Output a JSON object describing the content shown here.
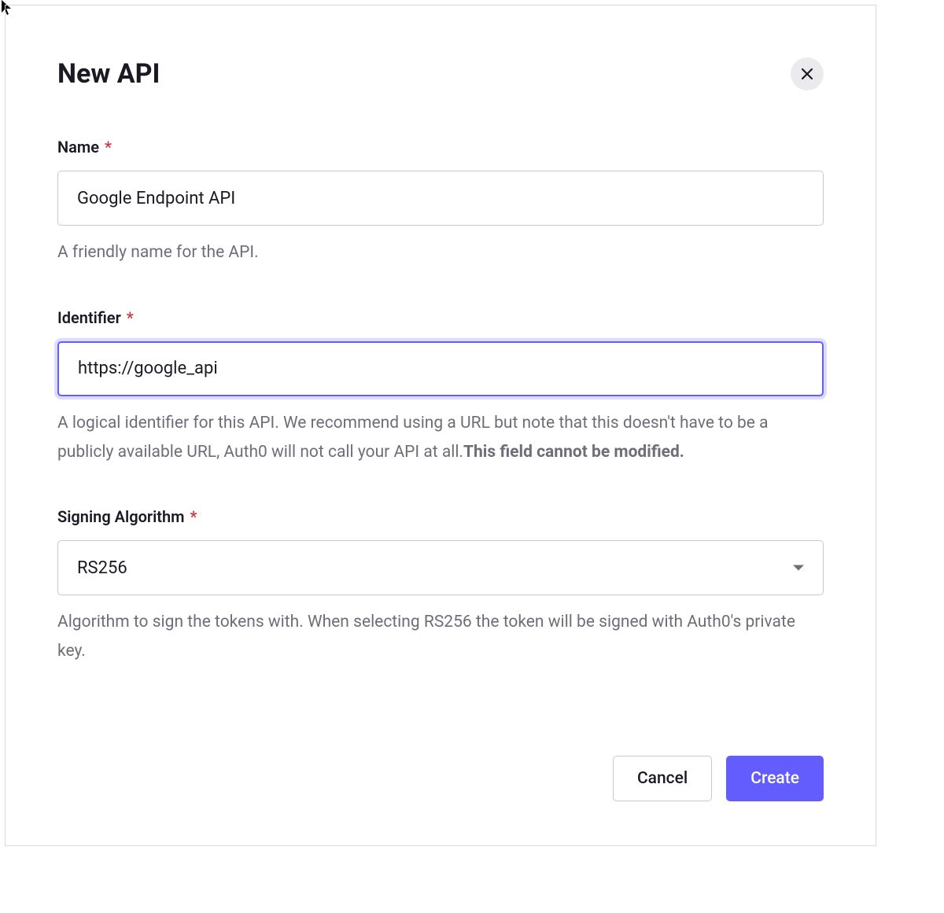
{
  "dialog": {
    "title": "New API",
    "fields": {
      "name": {
        "label": "Name",
        "value": "Google Endpoint API",
        "helper": "A friendly name for the API."
      },
      "identifier": {
        "label": "Identifier",
        "value": "https://google_api",
        "helper_prefix": "A logical identifier for this API. We recommend using a URL but note that this doesn't have to be a publicly available URL, Auth0 will not call your API at all.",
        "helper_bold": "This field cannot be modified."
      },
      "signing_algorithm": {
        "label": "Signing Algorithm",
        "value": "RS256",
        "helper": "Algorithm to sign the tokens with. When selecting RS256 the token will be signed with Auth0's private key."
      }
    },
    "buttons": {
      "cancel": "Cancel",
      "create": "Create"
    },
    "required_marker": "*"
  }
}
